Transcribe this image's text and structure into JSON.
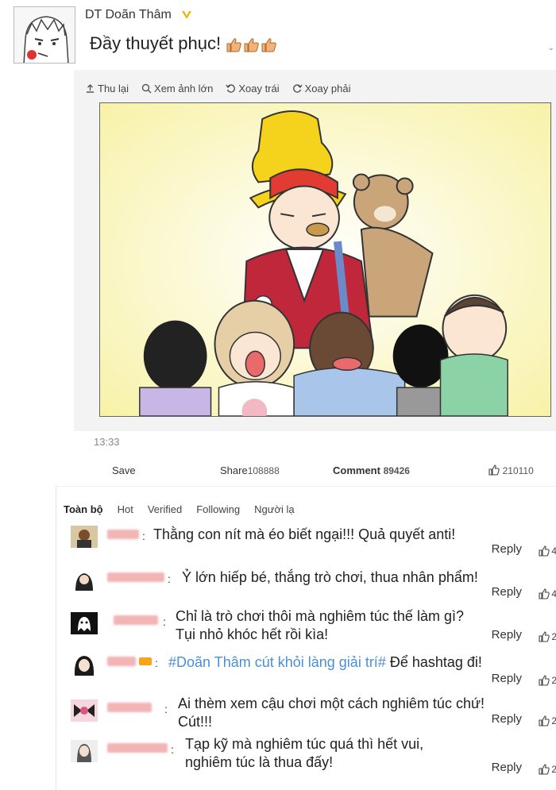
{
  "post": {
    "username": "DT Doãn Thâm",
    "text": "Đầy thuyết phục!",
    "verified_color": "#f0b400"
  },
  "toolbar": {
    "collapse": "Thu lại",
    "view_large": "Xem ảnh lớn",
    "rotate_left": "Xoay trái",
    "rotate_right": "Xoay phải"
  },
  "timestamp": "13:33",
  "actions": {
    "save": "Save",
    "share_label": "Share",
    "share_count": "108888",
    "comment_label": "Comment",
    "comment_count": "89426",
    "like_count": "210110"
  },
  "filters": [
    "Toàn bộ",
    "Hot",
    "Verified",
    "Following",
    "Người lạ"
  ],
  "comments": [
    {
      "text": "Thằng con nít mà éo biết ngại!!! Quả quyết anti!",
      "reply": "Reply",
      "likes": "4"
    },
    {
      "text": "Ỷ lớn hiếp bé, thắng trò chơi, thua nhân phẩm!",
      "reply": "Reply",
      "likes": "4"
    },
    {
      "line1": "Chỉ là trò chơi thôi mà nghiêm túc thế làm gì?",
      "line2": "Tụi nhỏ khóc hết rồi kìa!",
      "reply": "Reply",
      "likes": "2"
    },
    {
      "hashtag": "#Doãn Thâm cút khỏi làng giải trí#",
      "text": "Để hashtag đi!",
      "reply": "Reply",
      "likes": "2"
    },
    {
      "line1": "Ai thèm xem cậu chơi một cách nghiêm túc chứ!",
      "line2": "Cút!!!",
      "reply": "Reply",
      "likes": "2"
    },
    {
      "line1": "Tạp kỹ mà nghiêm túc quá thì hết vui,",
      "line2": "nghiêm túc là thua đấy!",
      "reply": "Reply",
      "likes": "2"
    }
  ],
  "colors": {
    "hashtag": "#4a8fd8",
    "blurred_name": "#f2b4b4",
    "background": "#ffffff",
    "panel": "#f3f3f3"
  }
}
